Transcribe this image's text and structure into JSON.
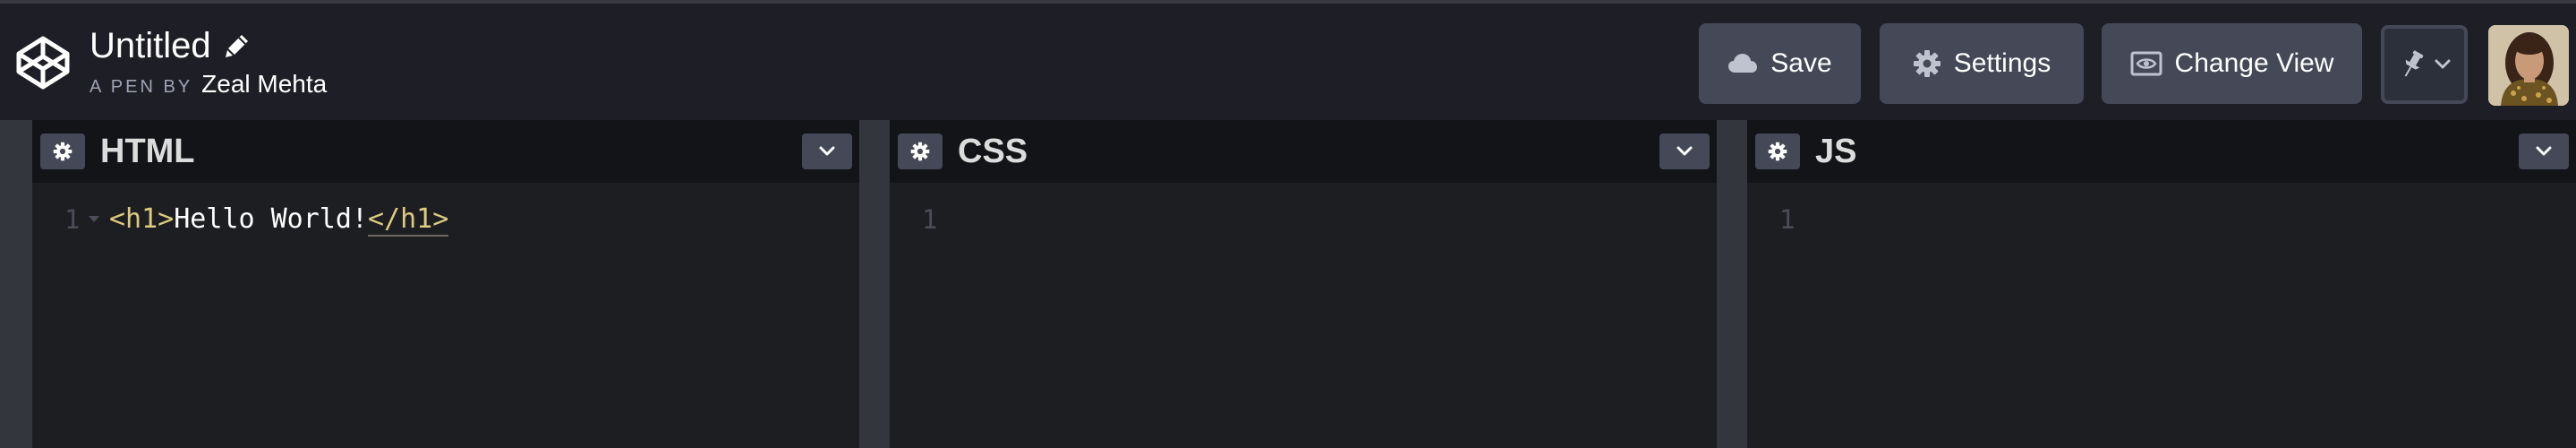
{
  "header": {
    "title": "Untitled",
    "byline_prefix": "A PEN BY",
    "author": "Zeal Mehta",
    "buttons": {
      "save": "Save",
      "settings": "Settings",
      "change_view": "Change View"
    }
  },
  "icons": {
    "logo": "codepen-logo-icon",
    "edit": "pencil-icon",
    "save": "cloud-icon",
    "settings": "gear-icon",
    "change_view": "eye-icon",
    "pin": "pin-icon",
    "dropdown": "chevron-down-icon"
  },
  "editors": [
    {
      "title": "HTML",
      "lines": [
        "1"
      ],
      "code": {
        "open_tag": "<h1>",
        "text": "Hello World!",
        "close_tag": "</h1>"
      }
    },
    {
      "title": "CSS",
      "lines": [
        "1"
      ]
    },
    {
      "title": "JS",
      "lines": [
        "1"
      ]
    }
  ],
  "colors": {
    "background": "#1e1f26",
    "editor_background": "#1d1e22",
    "editor_header": "#131417",
    "button": "#444857",
    "tag": "#ddca7e",
    "line_number": "#4b4d57"
  }
}
